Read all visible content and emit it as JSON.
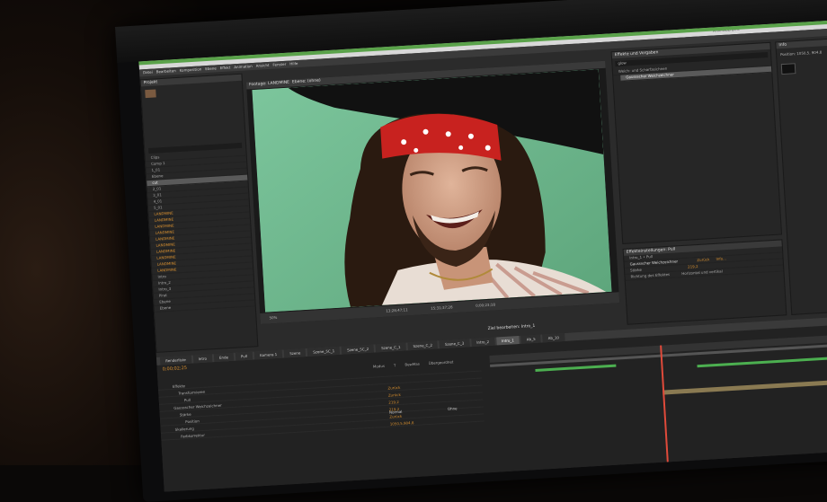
{
  "app": {
    "workspace": "Arbeitsbereich:",
    "menu": [
      "Datei",
      "Bearbeiten",
      "Komposition",
      "Ebene",
      "Effekt",
      "Animation",
      "Ansicht",
      "Fenster",
      "Hilfe"
    ]
  },
  "project": {
    "panel_title": "Projekt",
    "items": [
      "Clips",
      "Comp 1",
      "1_01",
      "Ebene",
      "cut",
      "2_01",
      "3_01",
      "4_01",
      "5_01",
      "LANDMINE",
      "LANDMINE",
      "LANDMINE",
      "LANDMINE",
      "LANDMINE",
      "LANDMINE",
      "LANDMINE",
      "LANDMINE",
      "LANDMINE",
      "LANDMINE",
      "Intro",
      "Intro_2",
      "Intro_3",
      "Pirat",
      "Ebene",
      "Ebene"
    ]
  },
  "viewer": {
    "tab": "Footage: LANDMINE",
    "tab2": "Ebene: (ohne)",
    "zoom": "50%",
    "timecode1": "13;28;47;11",
    "timecode2": "15;31;37;28",
    "timecode3": "0;00;23;18",
    "edit_target": "Ziel bearbeiten: Intro_1"
  },
  "effects": {
    "panel_title": "Effekte und Vorgaben",
    "search": "glow",
    "category": "Weich- und Scharfzeichnen",
    "result": "Gaussscher Weichzeichner"
  },
  "effect_controls": {
    "panel_title": "Effekteinstellungen: Pull",
    "layer": "Intro_1 • Pull",
    "effect_name": "Gaussscher Weichzeichner",
    "reset": "Zurück",
    "about": "Info...",
    "prop1": "Stärke",
    "prop1_value": "219,2",
    "prop2": "Richtung des Effektes",
    "prop2_value": "Horizontal und vertikal"
  },
  "info_panel": {
    "title": "Info",
    "position": "Position: 1050,5, 904,8"
  },
  "timeline": {
    "timecode": "0;00;02;25",
    "tabs": [
      "Renderliste",
      "Intro",
      "Ende",
      "Pull",
      "Kamera 1",
      "Szene",
      "Szene_5C_1",
      "Szene_5C_2",
      "Szene_C_1",
      "Szene_C_2",
      "Szene_C_3",
      "Intro_2",
      "Intro_1",
      "Ab_5",
      "Ab_10"
    ],
    "active_tab": "Intro_1",
    "columns": [
      "Modus",
      "T",
      "BewMas",
      "Übergeordnet"
    ],
    "layers": [
      {
        "name": "Effekte",
        "value": ""
      },
      {
        "name": "Transformieren",
        "value": ""
      },
      {
        "name": "Pull",
        "value": "Zurück"
      },
      {
        "name": "Gaussscher Weichzeichner",
        "value": "Zurück"
      },
      {
        "name": "Stärke",
        "value": "219,2"
      },
      {
        "name": "Position",
        "value": "219,2"
      },
      {
        "name": "Skalierung",
        "value": "Zurück"
      },
      {
        "name": "Farbkorrektur",
        "value": "1050,5,904,8"
      }
    ],
    "mode": "Normal",
    "parent": "Ohne"
  },
  "colors": {
    "green_screen": "#6db98e",
    "bandana": "#c8221f",
    "accent_orange": "#d9902f"
  }
}
